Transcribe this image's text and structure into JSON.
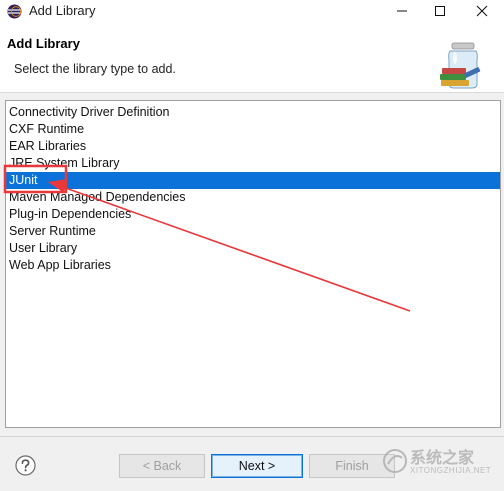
{
  "window": {
    "title": "Add Library",
    "icon": "eclipse-icon"
  },
  "header": {
    "title": "Add Library",
    "description": "Select the library type to add.",
    "icon": "library-jar-icon"
  },
  "library_types": [
    "Connectivity Driver Definition",
    "CXF Runtime",
    "EAR Libraries",
    "JRE System Library",
    "JUnit",
    "Maven Managed Dependencies",
    "Plug-in Dependencies",
    "Server Runtime",
    "User Library",
    "Web App Libraries"
  ],
  "selected": "JUnit",
  "buttons": {
    "back": "< Back",
    "next": "Next >",
    "finish": "Finish"
  },
  "annotation_color": "#e8383b",
  "watermark": {
    "text": "系统之家",
    "sub": "XITONGZHIJIA.NET"
  }
}
